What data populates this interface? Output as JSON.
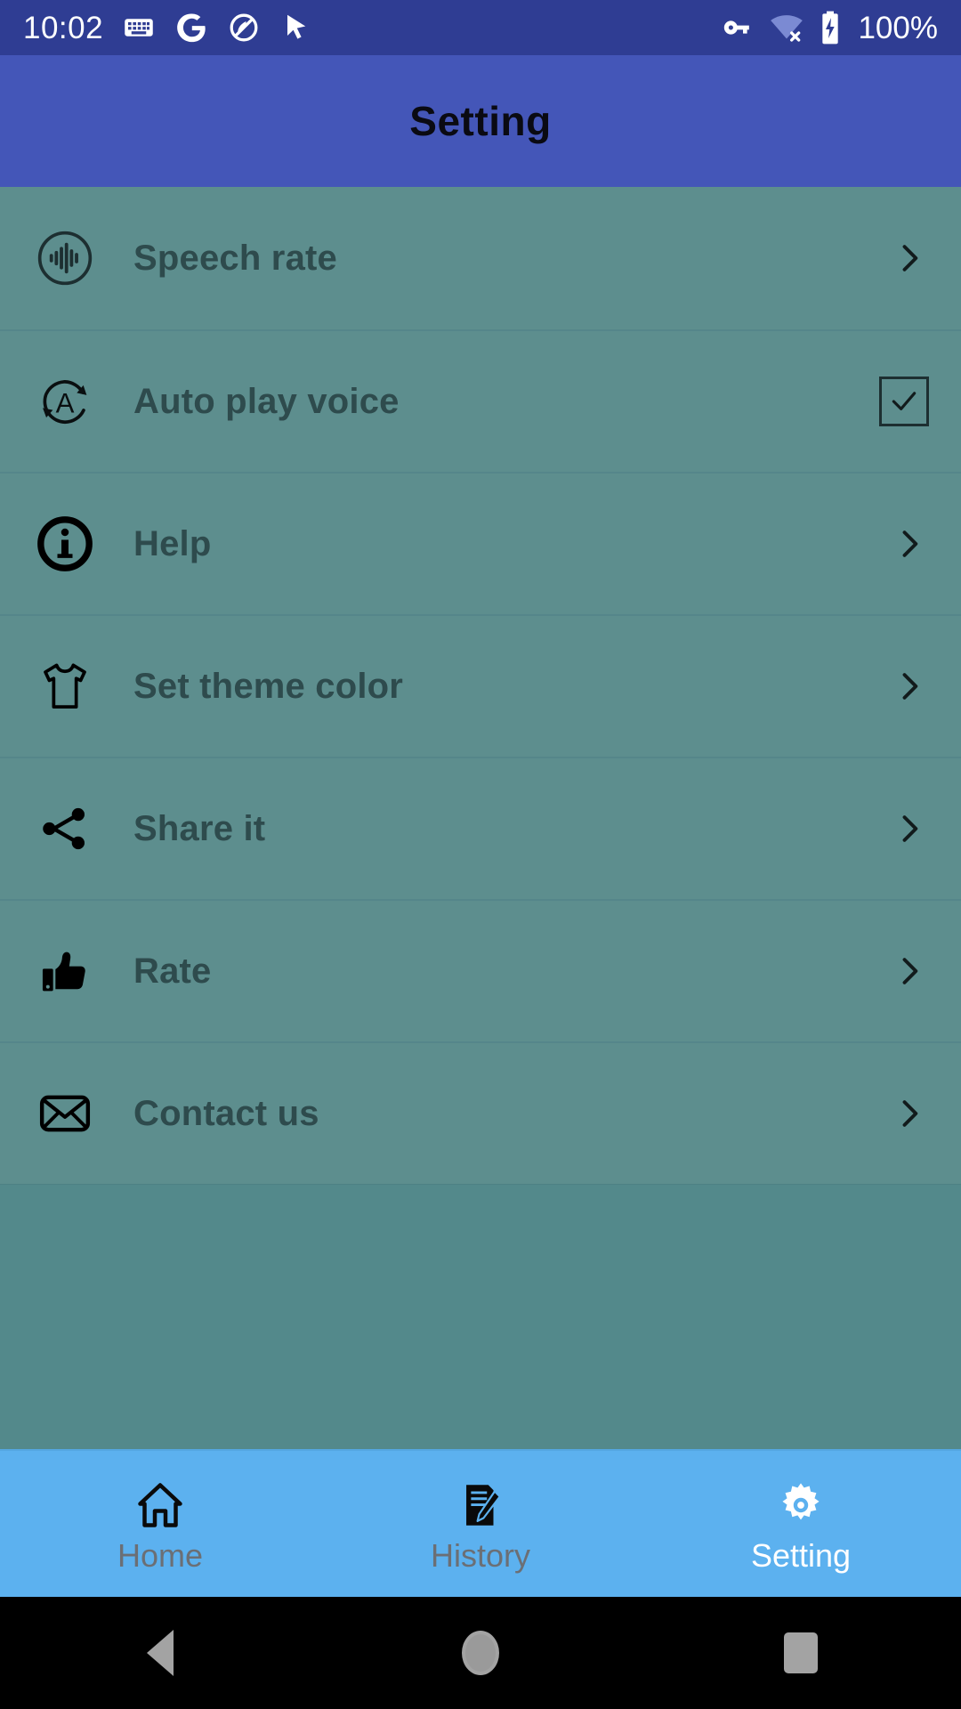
{
  "status_bar": {
    "clock": "10:02",
    "battery_text": "100%",
    "left_icons": [
      "keyboard-icon",
      "google-icon",
      "circle-slash-icon",
      "cursor-arrow-icon"
    ],
    "right_icons": [
      "vpn-key-icon",
      "wifi-off-icon",
      "battery-charging-icon"
    ],
    "background_color": "#2f3d93",
    "text_color": "#ffffff"
  },
  "header": {
    "title": "Setting",
    "background_color": "#4456b8",
    "title_color": "#0a0a12"
  },
  "settings": {
    "background_color": "#5d8e8e",
    "label_color": "#2e4b4d",
    "items": [
      {
        "label": "Speech rate",
        "icon": "speech-waveform-icon",
        "trailing": "chevron-right-icon"
      },
      {
        "label": "Auto play voice",
        "icon": "auto-repeat-a-icon",
        "trailing": "checkbox-checked",
        "checked": true
      },
      {
        "label": "Help",
        "icon": "info-circle-icon",
        "trailing": "chevron-right-icon"
      },
      {
        "label": "Set theme color",
        "icon": "tshirt-icon",
        "trailing": "chevron-right-icon"
      },
      {
        "label": "Share it",
        "icon": "share-nodes-icon",
        "trailing": "chevron-right-icon"
      },
      {
        "label": "Rate",
        "icon": "thumbs-up-icon",
        "trailing": "chevron-right-icon"
      },
      {
        "label": "Contact us",
        "icon": "envelope-icon",
        "trailing": "chevron-right-icon"
      }
    ]
  },
  "bottom_nav": {
    "background_color": "#5cb1ef",
    "inactive_color": "#6b6f75",
    "active_color": "#ffffff",
    "items": [
      {
        "label": "Home",
        "icon": "home-icon",
        "active": false
      },
      {
        "label": "History",
        "icon": "note-edit-icon",
        "active": false
      },
      {
        "label": "Setting",
        "icon": "gear-icon",
        "active": true
      }
    ]
  },
  "system_nav": {
    "background_color": "#000000",
    "buttons": [
      "back-button",
      "home-button",
      "recents-button"
    ]
  }
}
